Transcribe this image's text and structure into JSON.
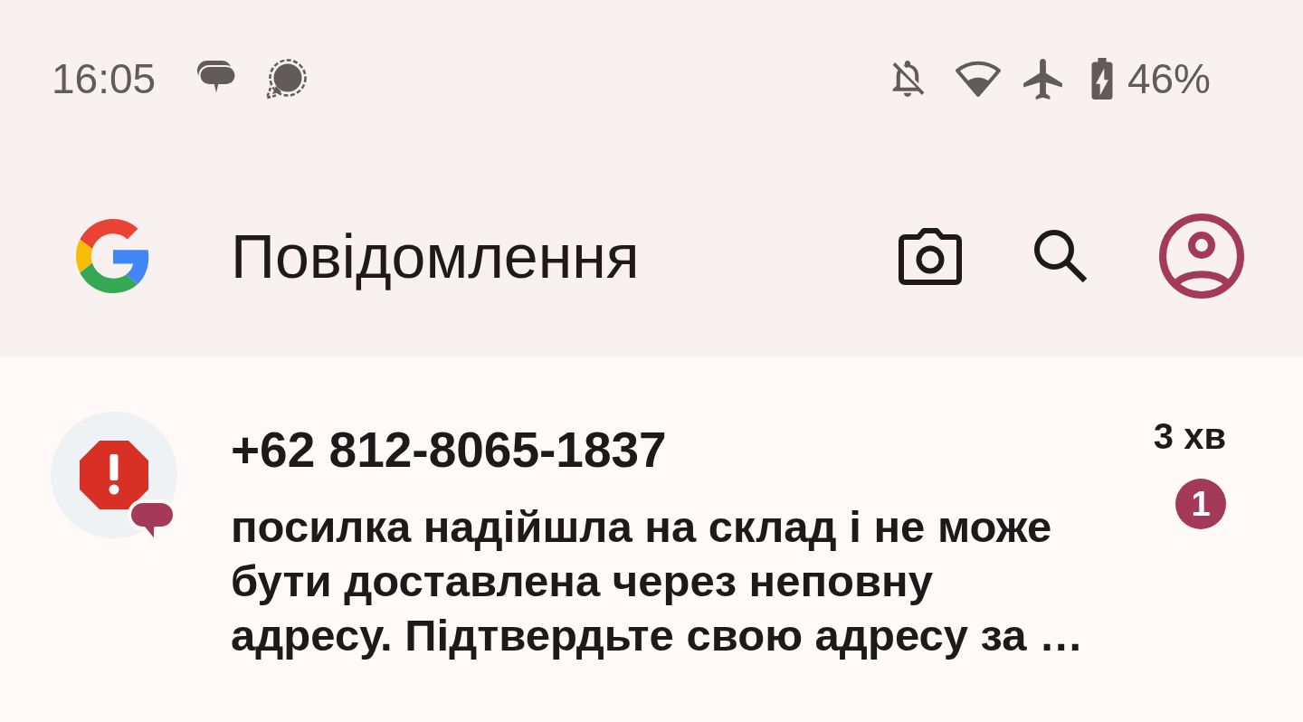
{
  "status_bar": {
    "time": "16:05",
    "battery": "46%"
  },
  "app_bar": {
    "title": "Повідомлення"
  },
  "conversations": [
    {
      "sender": "+62 812-8065-1837",
      "preview": "посилка надійшла на склад і не може бути доставлена через неповну адресу. Підтвердьте свою адресу за …",
      "time": "3 хв",
      "unread": true,
      "unread_count": "1"
    }
  ]
}
